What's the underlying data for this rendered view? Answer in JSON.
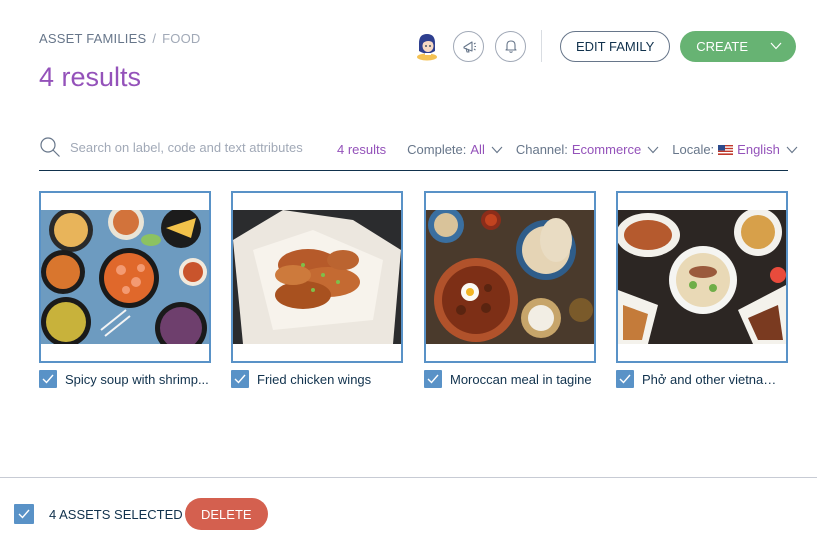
{
  "breadcrumb": {
    "root": "Asset families",
    "separator": "/",
    "current": "Food"
  },
  "page_title": "4 results",
  "header": {
    "avatar_icon": "user-avatar-icon",
    "share_icon": "megaphone-icon",
    "notifications_icon": "bell-icon",
    "edit_family_label": "Edit family",
    "create_label": "Create"
  },
  "search": {
    "placeholder": "Search on label, code and text attributes",
    "result_count": "4 results",
    "filters": {
      "complete_label": "Complete:",
      "complete_value": "All",
      "channel_label": "Channel:",
      "channel_value": "Ecommerce",
      "locale_label": "Locale:",
      "locale_value": "English"
    }
  },
  "assets": [
    {
      "label": "Spicy soup with shrimp...",
      "checked": true
    },
    {
      "label": "Fried chicken wings",
      "checked": true
    },
    {
      "label": "Moroccan meal in tagine",
      "checked": true
    },
    {
      "label": "Phở and other vietname...",
      "checked": true
    }
  ],
  "bottom_bar": {
    "selected_text": "4 assets selected",
    "delete_label": "Delete"
  },
  "colors": {
    "accent": "#9452ba",
    "create": "#67b373",
    "delete": "#d4604f",
    "selection": "#5992c7"
  }
}
